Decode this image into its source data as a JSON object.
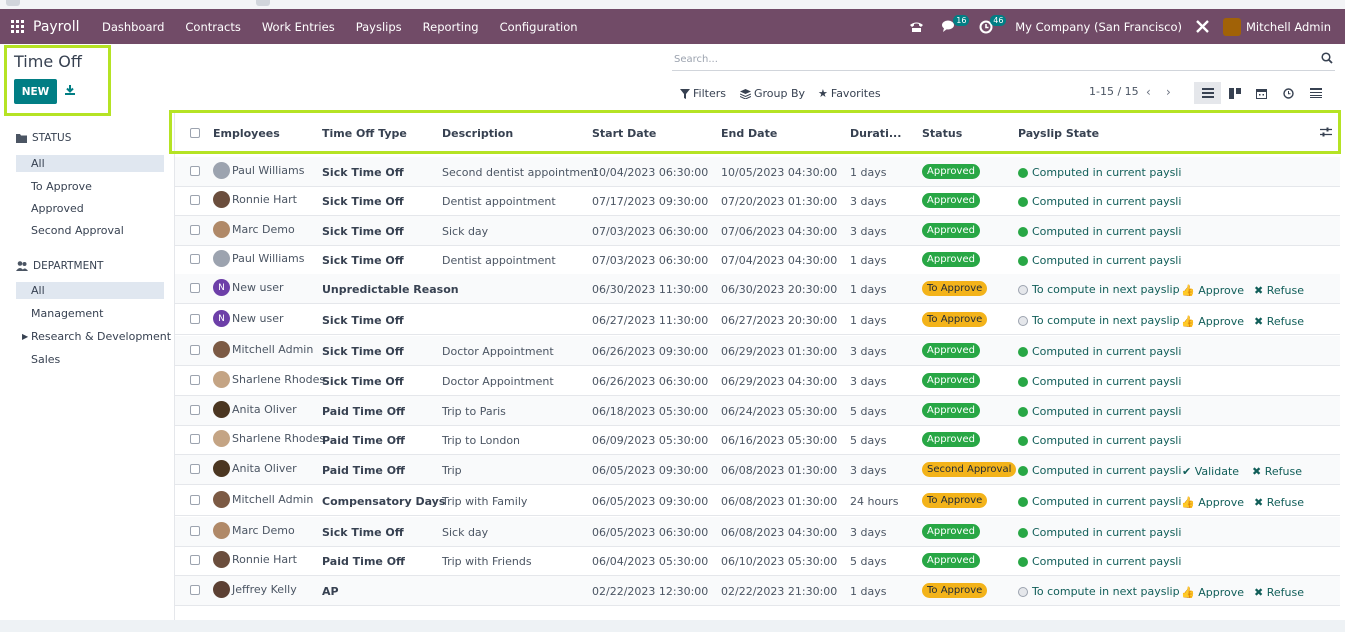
{
  "navbar": {
    "app_name": "Payroll",
    "menu": [
      "Dashboard",
      "Contracts",
      "Work Entries",
      "Payslips",
      "Reporting",
      "Configuration"
    ],
    "messages_count": "16",
    "activities_count": "46",
    "company": "My Company (San Francisco)",
    "user": "Mitchell Admin"
  },
  "page": {
    "title": "Time Off",
    "new_label": "NEW"
  },
  "search": {
    "placeholder": "Search..."
  },
  "controls": {
    "filters": "Filters",
    "group_by": "Group By",
    "favorites": "Favorites",
    "pager": "1-15 / 15"
  },
  "sidebar": {
    "status_heading": "STATUS",
    "status_items": [
      "All",
      "To Approve",
      "Approved",
      "Second Approval"
    ],
    "department_heading": "DEPARTMENT",
    "department_items": [
      "All",
      "Management",
      "Research & Development",
      "Sales"
    ]
  },
  "table": {
    "headers": [
      "Employees",
      "Time Off Type",
      "Description",
      "Start Date",
      "End Date",
      "Durati...",
      "Status",
      "Payslip State"
    ],
    "rows": [
      {
        "employee": "Paul Williams",
        "type": "Sick Time Off",
        "description": "Second dentist appointment",
        "start": "10/04/2023 06:30:00",
        "end": "10/05/2023 04:30:00",
        "duration": "1 days",
        "status": "Approved",
        "payslip": "Computed in current paysli"
      },
      {
        "employee": "Ronnie Hart",
        "type": "Sick Time Off",
        "description": "Dentist appointment",
        "start": "07/17/2023 09:30:00",
        "end": "07/20/2023 01:30:00",
        "duration": "3 days",
        "status": "Approved",
        "payslip": "Computed in current paysli"
      },
      {
        "employee": "Marc Demo",
        "type": "Sick Time Off",
        "description": "Sick day",
        "start": "07/03/2023 06:30:00",
        "end": "07/06/2023 04:30:00",
        "duration": "3 days",
        "status": "Approved",
        "payslip": "Computed in current paysli"
      },
      {
        "employee": "Paul Williams",
        "type": "Sick Time Off",
        "description": "Dentist appointment",
        "start": "07/03/2023 06:30:00",
        "end": "07/04/2023 04:30:00",
        "duration": "1 days",
        "status": "Approved",
        "payslip": "Computed in current paysli"
      },
      {
        "employee": "New user",
        "type": "Unpredictable Reason",
        "description": "",
        "start": "06/30/2023 11:30:00",
        "end": "06/30/2023 20:30:00",
        "duration": "1 days",
        "status": "To Approve",
        "payslip": "To compute in next payslip",
        "actions": [
          "Approve",
          "Refuse"
        ]
      },
      {
        "employee": "New user",
        "type": "Sick Time Off",
        "description": "",
        "start": "06/27/2023 11:30:00",
        "end": "06/27/2023 20:30:00",
        "duration": "1 days",
        "status": "To Approve",
        "payslip": "To compute in next payslip",
        "actions": [
          "Approve",
          "Refuse"
        ]
      },
      {
        "employee": "Mitchell Admin",
        "type": "Sick Time Off",
        "description": "Doctor Appointment",
        "start": "06/26/2023 09:30:00",
        "end": "06/29/2023 01:30:00",
        "duration": "3 days",
        "status": "Approved",
        "payslip": "Computed in current paysli"
      },
      {
        "employee": "Sharlene Rhodes",
        "type": "Sick Time Off",
        "description": "Doctor Appointment",
        "start": "06/26/2023 06:30:00",
        "end": "06/29/2023 04:30:00",
        "duration": "3 days",
        "status": "Approved",
        "payslip": "Computed in current paysli"
      },
      {
        "employee": "Anita Oliver",
        "type": "Paid Time Off",
        "description": "Trip to Paris",
        "start": "06/18/2023 05:30:00",
        "end": "06/24/2023 05:30:00",
        "duration": "5 days",
        "status": "Approved",
        "payslip": "Computed in current paysli"
      },
      {
        "employee": "Sharlene Rhodes",
        "type": "Paid Time Off",
        "description": "Trip to London",
        "start": "06/09/2023 05:30:00",
        "end": "06/16/2023 05:30:00",
        "duration": "5 days",
        "status": "Approved",
        "payslip": "Computed in current paysli"
      },
      {
        "employee": "Anita Oliver",
        "type": "Paid Time Off",
        "description": "Trip",
        "start": "06/05/2023 09:30:00",
        "end": "06/08/2023 01:30:00",
        "duration": "3 days",
        "status": "Second Approval",
        "payslip": "Computed in current paysli",
        "actions": [
          "Validate",
          "Refuse"
        ]
      },
      {
        "employee": "Mitchell Admin",
        "type": "Compensatory Days",
        "description": "Trip with Family",
        "start": "06/05/2023 09:30:00",
        "end": "06/08/2023 01:30:00",
        "duration": "24 hours",
        "status": "To Approve",
        "payslip": "Computed in current paysli",
        "actions": [
          "Approve",
          "Refuse"
        ]
      },
      {
        "employee": "Marc Demo",
        "type": "Sick Time Off",
        "description": "Sick day",
        "start": "06/05/2023 06:30:00",
        "end": "06/08/2023 04:30:00",
        "duration": "3 days",
        "status": "Approved",
        "payslip": "Computed in current paysli"
      },
      {
        "employee": "Ronnie Hart",
        "type": "Paid Time Off",
        "description": "Trip with Friends",
        "start": "06/04/2023 05:30:00",
        "end": "06/10/2023 05:30:00",
        "duration": "5 days",
        "status": "Approved",
        "payslip": "Computed in current paysli"
      },
      {
        "employee": "Jeffrey Kelly",
        "type": "AP",
        "description": "",
        "start": "02/22/2023 12:30:00",
        "end": "02/22/2023 21:30:00",
        "duration": "1 days",
        "status": "To Approve",
        "payslip": "To compute in next payslip",
        "actions": [
          "Approve",
          "Refuse"
        ]
      }
    ]
  },
  "colors": {
    "navbar": "#714b67",
    "primary": "#017e84",
    "approved": "#28a745",
    "to_approve": "#f3b31a",
    "highlight": "#b5e324"
  }
}
